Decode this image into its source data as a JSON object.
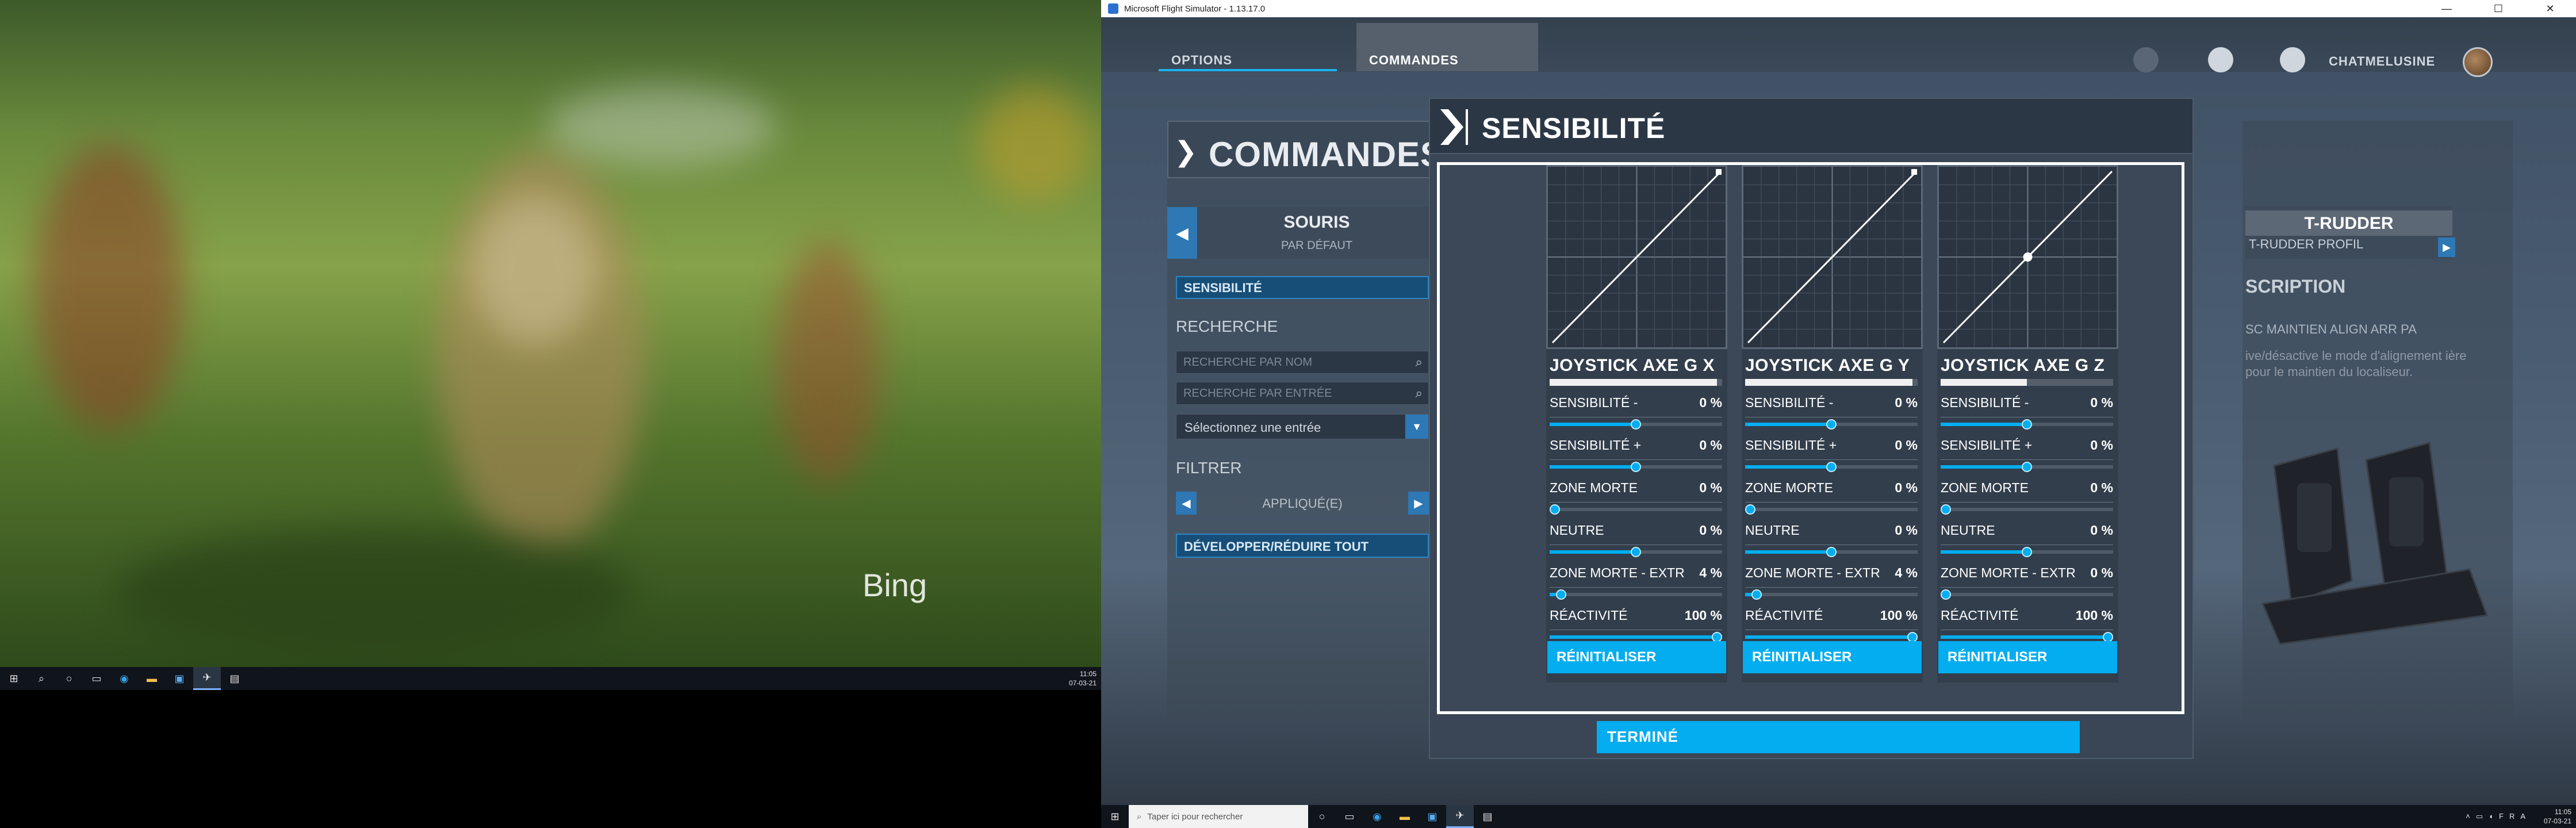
{
  "left_monitor": {
    "watermark": "Bing",
    "taskbar": {
      "clock_time": "11:05",
      "clock_date": "07-03-21"
    }
  },
  "window": {
    "title": "Microsoft Flight Simulator - 1.13.17.0",
    "min": "—",
    "max": "☐",
    "close": "✕"
  },
  "topnav": {
    "tabs": [
      "OPTIONS",
      "COMMANDES"
    ],
    "username": "CHATMELUSINE"
  },
  "left_panel": {
    "title": "COMMANDES",
    "device": "SOURIS",
    "device_profile": "PAR DÉFAUT",
    "sensitivity_button": "SENSIBILITÉ",
    "search_heading": "RECHERCHE",
    "search_by_name_placeholder": "RECHERCHE PAR NOM",
    "search_by_input_placeholder": "RECHERCHE PAR ENTRÉE",
    "select_entry": "Sélectionnez une entrée",
    "filter_heading": "FILTRER",
    "filter_value": "APPLIQUÉ(E)",
    "expand_collapse": "DÉVELOPPER/RÉDUIRE TOUT"
  },
  "right_panel": {
    "device": "T-RUDDER",
    "device_profile": "T-RUDDER PROFIL",
    "description_title": "SCRIPTION",
    "description_name": "SC MAINTIEN ALIGN ARR PA",
    "description_text": "ive/désactive le mode d'alignement ière pour le maintien du localiseur."
  },
  "modal": {
    "title": "SENSIBILITÉ",
    "done_button": "TERMINÉ",
    "axes": [
      {
        "name": "JOYSTICK AXE G X",
        "bar_fill": 0.97,
        "curve_midpoint": false,
        "params": [
          {
            "label": "SENSIBILITÉ -",
            "value": "0 %",
            "slider": 0.5
          },
          {
            "label": "SENSIBILITÉ +",
            "value": "0 %",
            "slider": 0.5
          },
          {
            "label": "ZONE MORTE",
            "value": "0 %",
            "slider": 0.0
          },
          {
            "label": "NEUTRE",
            "value": "0 %",
            "slider": 0.5
          },
          {
            "label": "ZONE MORTE - EXTRÊMI...",
            "value": "4 %",
            "slider": 0.04
          },
          {
            "label": "RÉACTIVITÉ",
            "value": "100 %",
            "slider": 1.0
          }
        ],
        "reset": "RÉINITIALISER"
      },
      {
        "name": "JOYSTICK AXE G Y",
        "bar_fill": 0.97,
        "curve_midpoint": false,
        "params": [
          {
            "label": "SENSIBILITÉ -",
            "value": "0 %",
            "slider": 0.5
          },
          {
            "label": "SENSIBILITÉ +",
            "value": "0 %",
            "slider": 0.5
          },
          {
            "label": "ZONE MORTE",
            "value": "0 %",
            "slider": 0.0
          },
          {
            "label": "NEUTRE",
            "value": "0 %",
            "slider": 0.5
          },
          {
            "label": "ZONE MORTE - EXTRÊMI...",
            "value": "4 %",
            "slider": 0.04
          },
          {
            "label": "RÉACTIVITÉ",
            "value": "100 %",
            "slider": 1.0
          }
        ],
        "reset": "RÉINITIALISER"
      },
      {
        "name": "JOYSTICK AXE G Z",
        "bar_fill": 0.5,
        "curve_midpoint": true,
        "params": [
          {
            "label": "SENSIBILITÉ -",
            "value": "0 %",
            "slider": 0.5
          },
          {
            "label": "SENSIBILITÉ +",
            "value": "0 %",
            "slider": 0.5
          },
          {
            "label": "ZONE MORTE",
            "value": "0 %",
            "slider": 0.0
          },
          {
            "label": "NEUTRE",
            "value": "0 %",
            "slider": 0.5
          },
          {
            "label": "ZONE MORTE - EXTRÊMI...",
            "value": "0 %",
            "slider": 0.0
          },
          {
            "label": "RÉACTIVITÉ",
            "value": "100 %",
            "slider": 1.0
          }
        ],
        "reset": "RÉINITIALISER"
      }
    ]
  },
  "right_taskbar": {
    "search_placeholder": "Taper ici pour rechercher",
    "language": "FRA",
    "clock_time": "11:05",
    "clock_date": "07-03-21"
  },
  "colors": {
    "accent": "#03adf0",
    "modal_bg": "#3a4655",
    "nav_bg": "#34414f"
  }
}
